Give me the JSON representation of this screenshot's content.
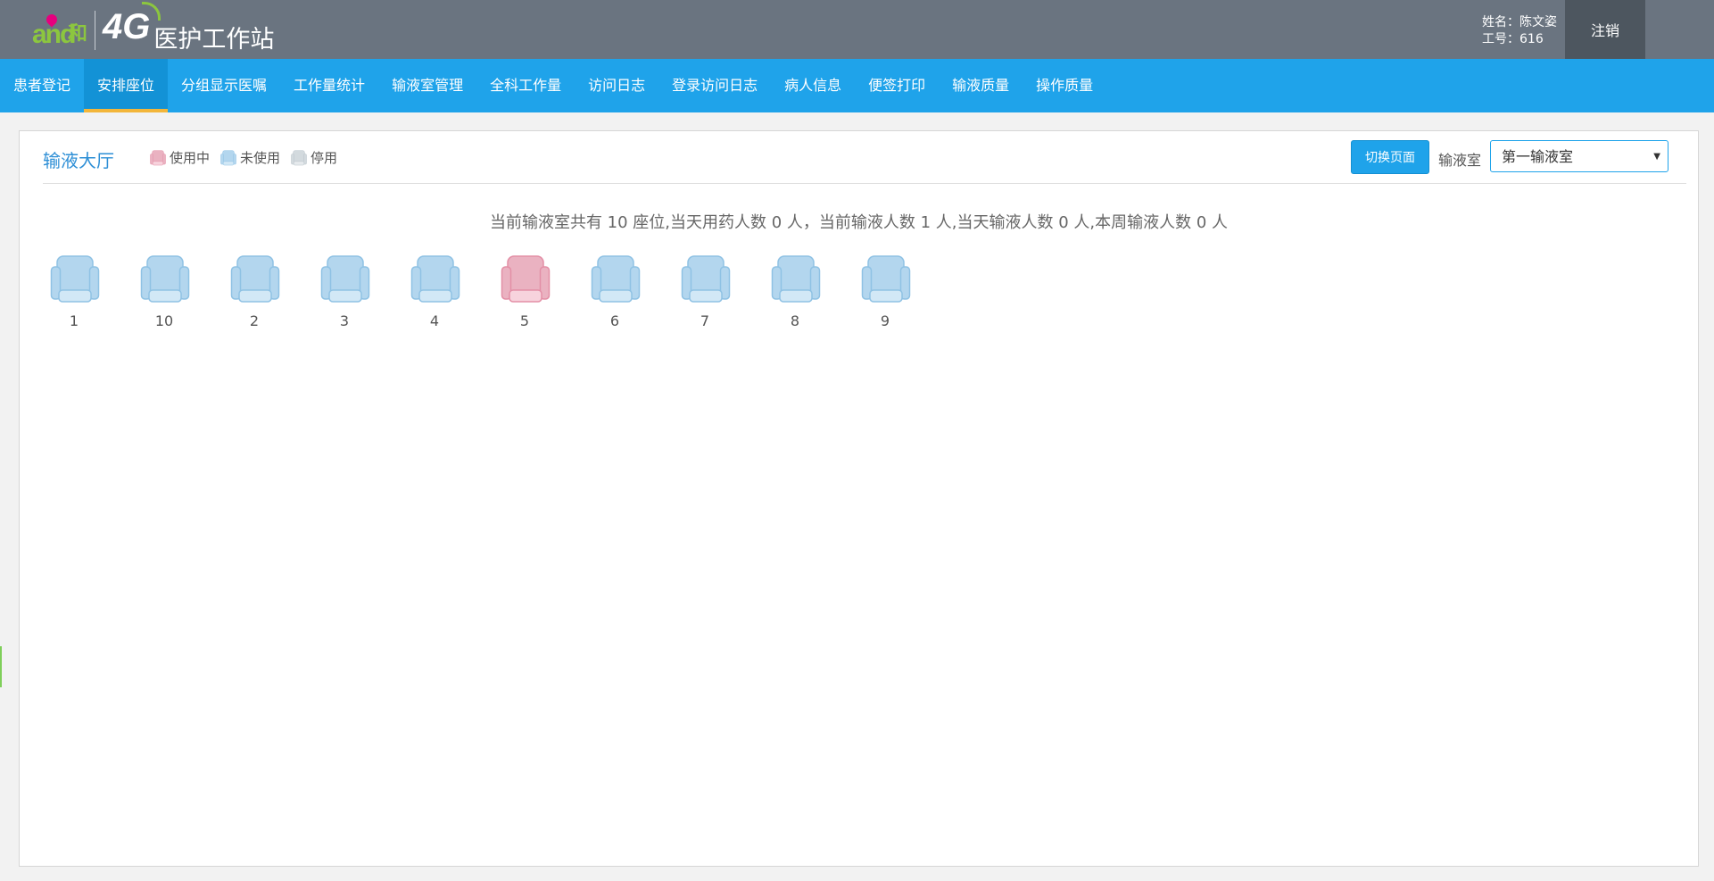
{
  "header": {
    "brand_name": "和",
    "brand_mark": "and",
    "network_label": "4G",
    "app_title": "医护工作站",
    "user_name": "姓名：陈文姿",
    "user_id": "工号：616",
    "logout_label": "注销",
    "colors": {
      "background": "#6a7480",
      "logout_background": "#4d565f",
      "brand_green": "#8cc63f",
      "brand_pink": "#e6007e"
    }
  },
  "nav": {
    "items": [
      {
        "label": "患者登记",
        "active": false
      },
      {
        "label": "安排座位",
        "active": true
      },
      {
        "label": "分组显示医嘱",
        "active": false
      },
      {
        "label": "工作量统计",
        "active": false
      },
      {
        "label": "输液室管理",
        "active": false
      },
      {
        "label": "全科工作量",
        "active": false
      },
      {
        "label": "访问日志",
        "active": false
      },
      {
        "label": "登录访问日志",
        "active": false
      },
      {
        "label": "病人信息",
        "active": false
      },
      {
        "label": "便签打印",
        "active": false
      },
      {
        "label": "输液质量",
        "active": false
      },
      {
        "label": "操作质量",
        "active": false
      }
    ],
    "colors": {
      "background": "#1fa3ea",
      "active_background": "#1392d6",
      "active_underline": "#f3b63a"
    }
  },
  "panel": {
    "title": "输液大厅",
    "legend": [
      {
        "label": "使用中",
        "status": "in-use",
        "color": "#f4a8b8"
      },
      {
        "label": "未使用",
        "status": "free",
        "color": "#a9d3ee"
      },
      {
        "label": "停用",
        "status": "disabled",
        "color": "#c9d2d9"
      }
    ],
    "switch_button_label": "切换页面",
    "room_label": "输液室",
    "room_selected": "第一输液室",
    "summary": "当前输液室共有 10 座位,当天用药人数 0 人，当前输液人数 1 人,当天输液人数 0 人,本周输液人数 0 人"
  },
  "seats": [
    {
      "number": "1",
      "status": "free"
    },
    {
      "number": "10",
      "status": "free"
    },
    {
      "number": "2",
      "status": "free"
    },
    {
      "number": "3",
      "status": "free"
    },
    {
      "number": "4",
      "status": "free"
    },
    {
      "number": "5",
      "status": "in-use"
    },
    {
      "number": "6",
      "status": "free"
    },
    {
      "number": "7",
      "status": "free"
    },
    {
      "number": "8",
      "status": "free"
    },
    {
      "number": "9",
      "status": "free"
    }
  ]
}
